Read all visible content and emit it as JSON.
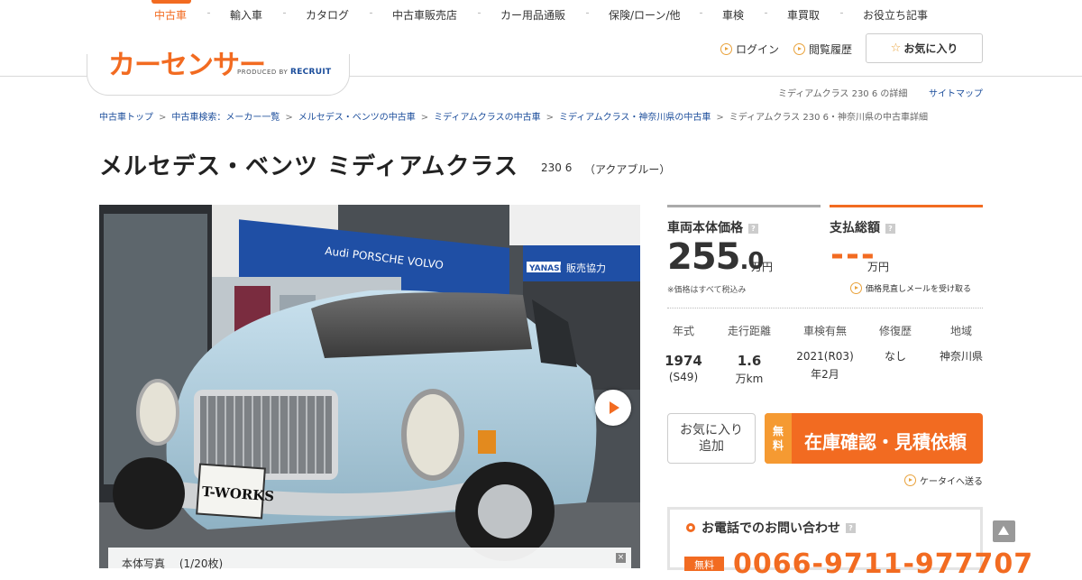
{
  "topnav": {
    "items": [
      "中古車",
      "輸入車",
      "カタログ",
      "中古車販売店",
      "カー用品通販",
      "保険/ローン/他",
      "車検",
      "車買取",
      "お役立ち記事"
    ]
  },
  "header": {
    "logo": "カーセンサー",
    "produced_by": "PRODUCED BY",
    "recruit": "RECRUIT",
    "login": "ログイン",
    "history": "閲覧履歴",
    "favorites": "お気に入り",
    "page_desc": "ミディアムクラス 230 6 の詳細",
    "sitemap": "サイトマップ"
  },
  "breadcrumb": [
    "中古車トップ",
    "中古車検索：メーカー一覧",
    "メルセデス・ベンツの中古車",
    "ミディアムクラスの中古車",
    "ミディアムクラス・神奈川県の中古車",
    "ミディアムクラス 230 6・神奈川県の中古車詳細"
  ],
  "car": {
    "title": "メルセデス・ベンツ ミディアムクラス",
    "grade": "230 6",
    "color": "（アクアブルー）"
  },
  "photo": {
    "caption": "本体写真",
    "counter": "(1/20枚)",
    "plate": "T-WORKS",
    "sign_brands": "Audi PORSCHE VOLVO",
    "sign_yanase": "YANASE",
    "sign_jp": "販売協力"
  },
  "price": {
    "body_label": "車両本体価格",
    "body_int": "255",
    "body_dec": ".0",
    "unit": "万円",
    "total_label": "支払総額",
    "total_value": "---",
    "total_unit": "万円",
    "tax_note": "※価格はすべて税込み",
    "mail_note": "価格見直しメールを受け取る"
  },
  "specs": [
    {
      "label": "年式",
      "value": "1974",
      "sub": "(S49)"
    },
    {
      "label": "走行距離",
      "value": "1.6",
      "sub": "万km"
    },
    {
      "label": "車検有無",
      "value": "2021(R03)",
      "sub": "年2月"
    },
    {
      "label": "修復歴",
      "value": "なし",
      "sub": ""
    },
    {
      "label": "地域",
      "value": "神奈川県",
      "sub": ""
    }
  ],
  "actions": {
    "fav_line1": "お気に入り",
    "fav_line2": "追加",
    "free1": "無",
    "free2": "料",
    "cta": "在庫確認・見積依頼",
    "ketai": "ケータイへ送る"
  },
  "contact": {
    "title": "お電話でのお問い合わせ",
    "free": "無料",
    "number": "0066-9711-977707"
  },
  "colors": {
    "accent": "#f26b21",
    "link": "#1b4d9b"
  }
}
